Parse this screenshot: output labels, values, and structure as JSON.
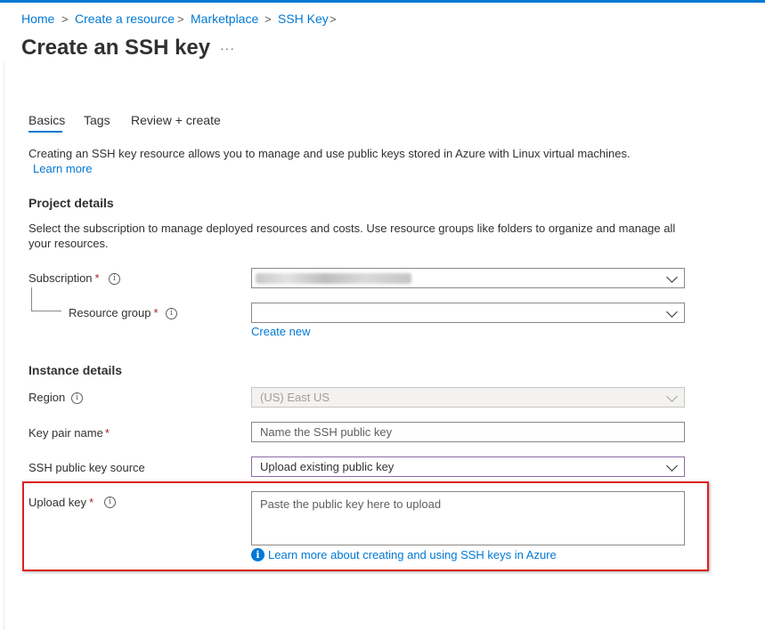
{
  "breadcrumb": {
    "items": [
      "Home",
      "Create a resource",
      "Marketplace",
      "SSH Key"
    ],
    "separator": ">"
  },
  "page": {
    "title": "Create an SSH key",
    "more": "···"
  },
  "tabs": [
    {
      "label": "Basics",
      "active": true
    },
    {
      "label": "Tags",
      "active": false
    },
    {
      "label": "Review + create",
      "active": false
    }
  ],
  "intro": {
    "text": "Creating an SSH key resource allows you to manage and use public keys stored in Azure with Linux virtual machines.",
    "learn_more": "Learn more"
  },
  "project": {
    "heading": "Project details",
    "description": "Select the subscription to manage deployed resources and costs. Use resource groups like folders to organize and manage all your resources.",
    "subscription_label": "Subscription",
    "resource_group_label": "Resource group",
    "resource_group_value": "",
    "create_new": "Create new"
  },
  "instance": {
    "heading": "Instance details",
    "region_label": "Region",
    "region_value": "(US) East US",
    "key_pair_label": "Key pair name",
    "key_pair_placeholder": "Name the SSH public key",
    "source_label": "SSH public key source",
    "source_value": "Upload existing public key",
    "upload_label": "Upload key",
    "upload_placeholder": "Paste the public key here to upload",
    "upload_help": "Learn more about creating and using SSH keys in Azure"
  },
  "required_mark": "*",
  "info_glyph": "i",
  "colors": {
    "accent": "#0078d4",
    "required": "#a4262c",
    "highlight": "#e02020"
  }
}
